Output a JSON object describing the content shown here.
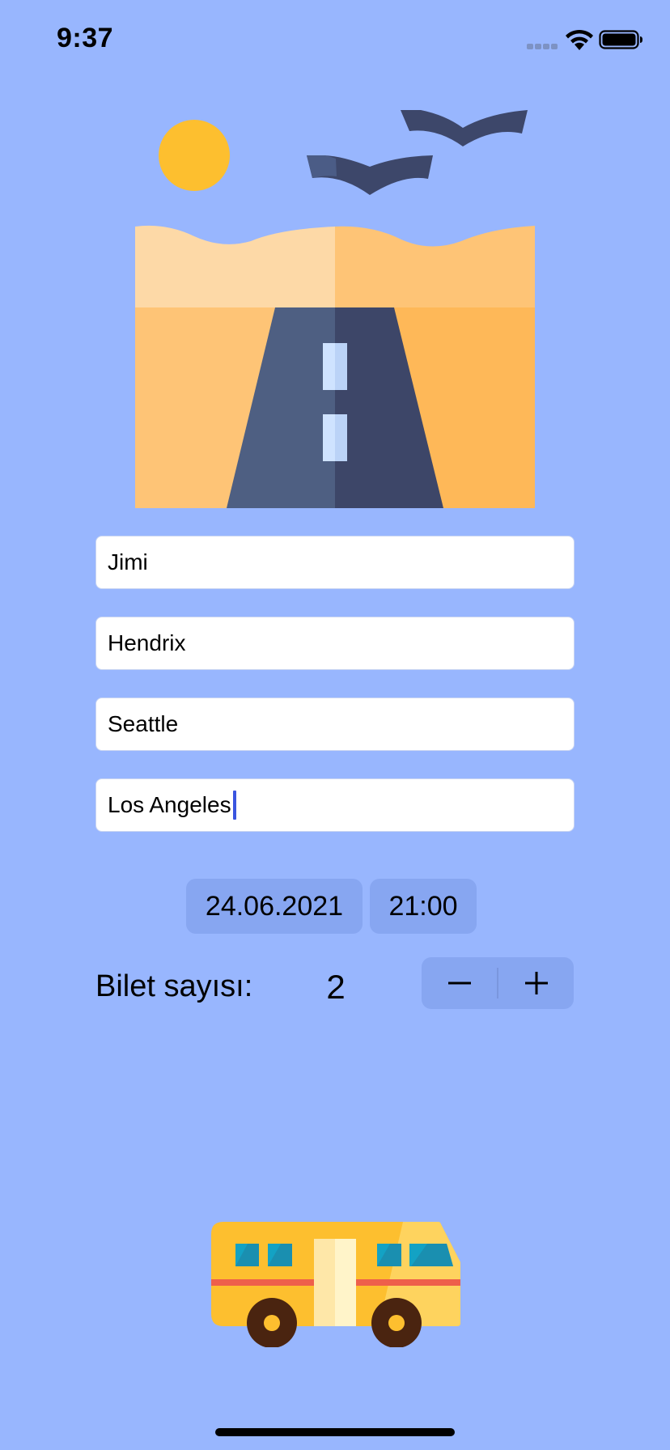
{
  "status_bar": {
    "time": "9:37"
  },
  "form": {
    "first_name": "Jimi",
    "last_name": "Hendrix",
    "from_city": "Seattle",
    "to_city": "Los Angeles",
    "date": "24.06.2021",
    "time": "21:00"
  },
  "tickets": {
    "label": "Bilet sayısı:",
    "count": "2",
    "decrement_label": "−",
    "increment_label": "+"
  },
  "icons": {
    "hero": "desert-road-illustration",
    "bus": "bus-illustration",
    "signal": "cellular-signal-icon",
    "wifi": "wifi-icon",
    "battery": "battery-icon"
  },
  "colors": {
    "background": "#98b6fe",
    "control_fill": "#87a6f1",
    "caret": "#3a55e0"
  }
}
